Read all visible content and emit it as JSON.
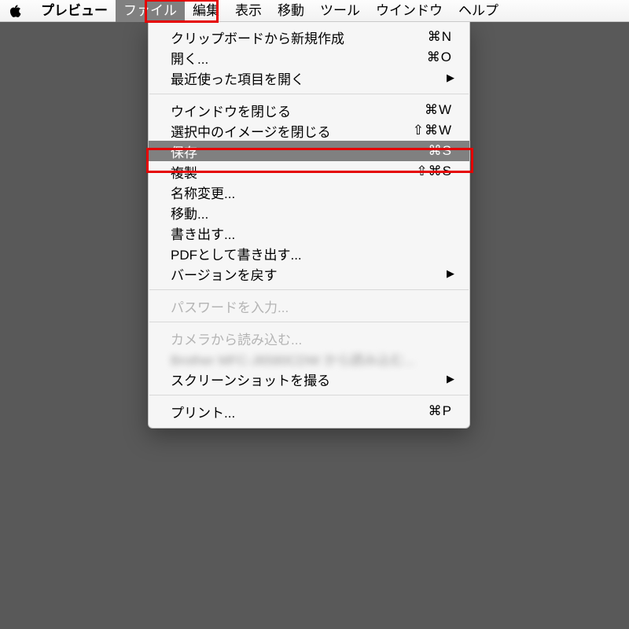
{
  "menubar": {
    "app_name": "プレビュー",
    "items": [
      "ファイル",
      "編集",
      "表示",
      "移動",
      "ツール",
      "ウインドウ",
      "ヘルプ"
    ],
    "active_index": 0
  },
  "dropdown": {
    "groups": [
      [
        {
          "label": "クリップボードから新規作成",
          "shortcut": "⌘N"
        },
        {
          "label": "開く...",
          "shortcut": "⌘O"
        },
        {
          "label": "最近使った項目を開く",
          "submenu": true
        }
      ],
      [
        {
          "label": "ウインドウを閉じる",
          "shortcut": "⌘W"
        },
        {
          "label": "選択中のイメージを閉じる",
          "shortcut": "⇧⌘W"
        },
        {
          "label": "保存",
          "shortcut": "⌘S",
          "selected": true
        },
        {
          "label": "複製",
          "shortcut": "⇧⌘S"
        },
        {
          "label": "名称変更..."
        },
        {
          "label": "移動..."
        },
        {
          "label": "書き出す..."
        },
        {
          "label": "PDFとして書き出す..."
        },
        {
          "label": "バージョンを戻す",
          "submenu": true
        }
      ],
      [
        {
          "label": "パスワードを入力...",
          "disabled": true
        }
      ],
      [
        {
          "label": "カメラから読み込む...",
          "disabled": true
        },
        {
          "label": "Brother MFC-J6580CDW から読み込む...",
          "blurred": true
        },
        {
          "label": "スクリーンショットを撮る",
          "submenu": true
        }
      ],
      [
        {
          "label": "プリント...",
          "shortcut": "⌘P"
        }
      ]
    ]
  }
}
